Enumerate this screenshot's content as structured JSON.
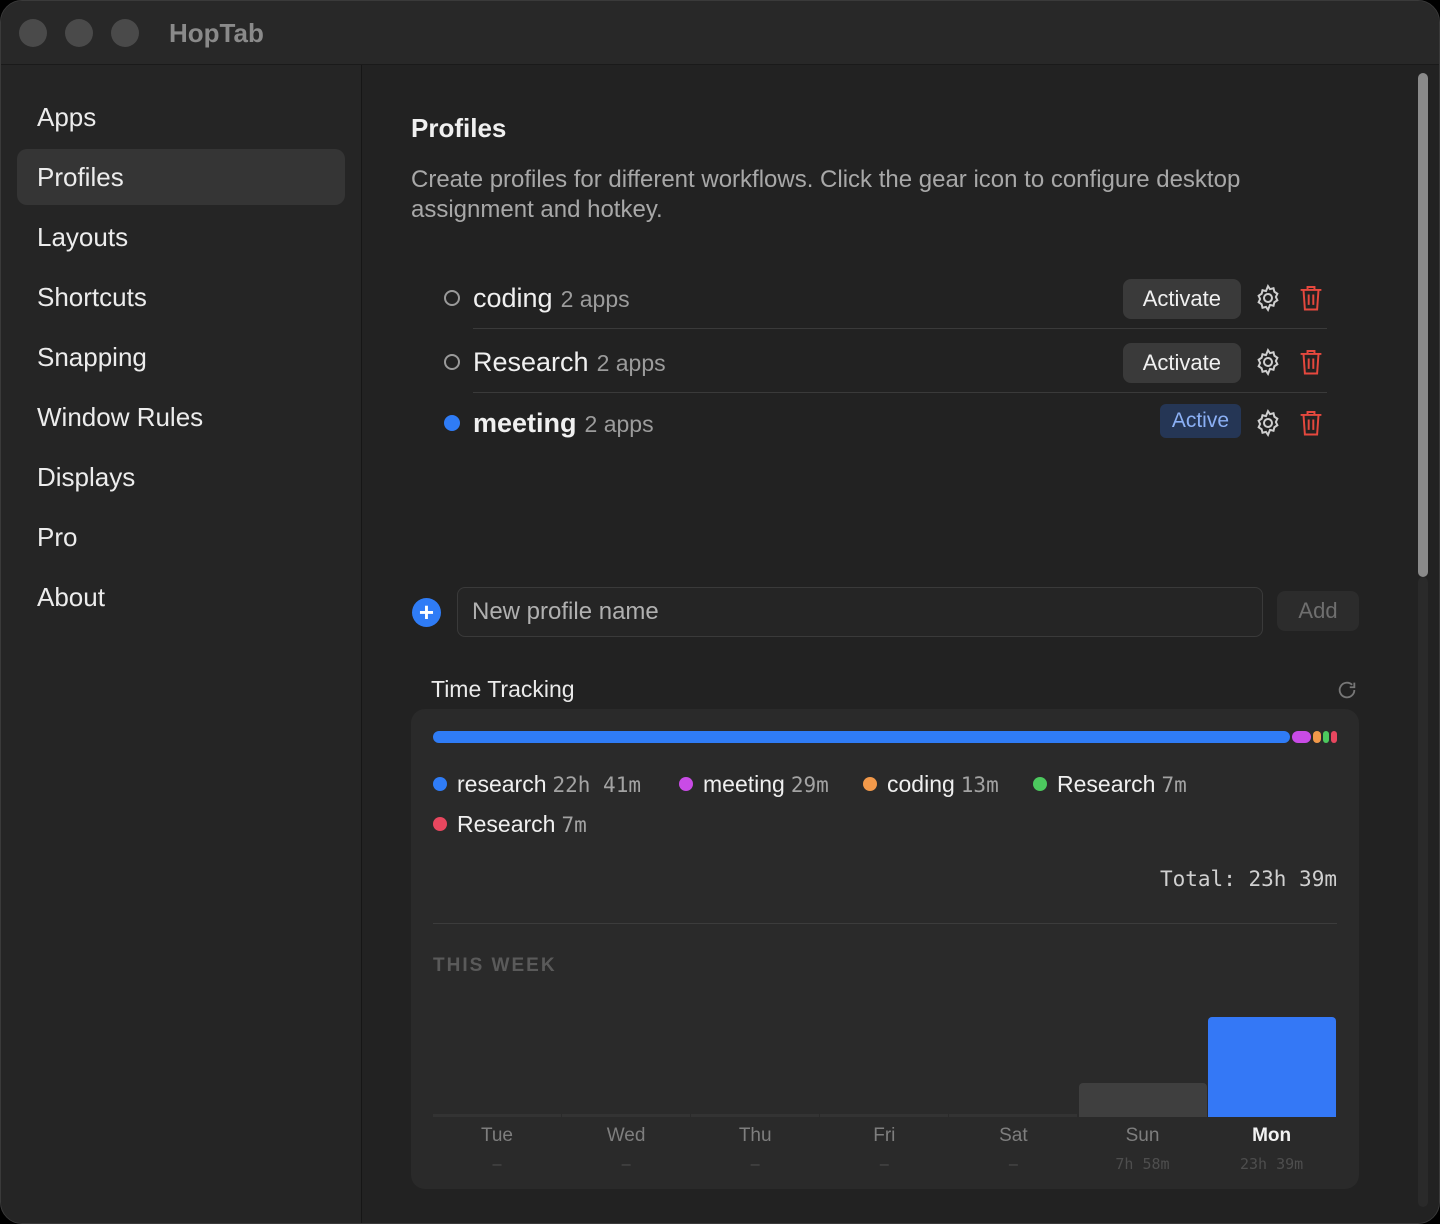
{
  "window": {
    "title": "HopTab"
  },
  "sidebar": {
    "items": [
      {
        "label": "Apps"
      },
      {
        "label": "Profiles",
        "selected": true
      },
      {
        "label": "Layouts"
      },
      {
        "label": "Shortcuts"
      },
      {
        "label": "Snapping"
      },
      {
        "label": "Window Rules"
      },
      {
        "label": "Displays"
      },
      {
        "label": "Pro"
      },
      {
        "label": "About"
      }
    ]
  },
  "main": {
    "title": "Profiles",
    "description": "Create profiles for different workflows. Click the gear icon to configure desktop assignment and hotkey.",
    "profiles": [
      {
        "name": "coding",
        "count": "2 apps",
        "action": "Activate",
        "active": false
      },
      {
        "name": "Research",
        "count": "2 apps",
        "action": "Activate",
        "active": false
      },
      {
        "name": "meeting",
        "count": "2 apps",
        "action": "Active",
        "active": true
      }
    ],
    "new_profile": {
      "placeholder": "New profile name",
      "add_label": "Add"
    }
  },
  "time_tracking": {
    "title": "Time Tracking",
    "distribution": [
      {
        "name": "research",
        "duration": "22h 41m",
        "color": "#2f7cf6",
        "minutes": 1361
      },
      {
        "name": "meeting",
        "duration": "29m",
        "color": "#c94be6",
        "minutes": 29
      },
      {
        "name": "coding",
        "duration": "13m",
        "color": "#f2994a",
        "minutes": 13
      },
      {
        "name": "Research",
        "duration": "7m",
        "color": "#4cc95e",
        "minutes": 7
      },
      {
        "name": "Research",
        "duration": "7m",
        "color": "#e8475f",
        "minutes": 7
      }
    ],
    "total": "Total: 23h 39m",
    "week_label": "THIS WEEK",
    "week": [
      {
        "day": "Tue",
        "value": "–",
        "hours": 0
      },
      {
        "day": "Wed",
        "value": "–",
        "hours": 0
      },
      {
        "day": "Thu",
        "value": "–",
        "hours": 0
      },
      {
        "day": "Fri",
        "value": "–",
        "hours": 0
      },
      {
        "day": "Sat",
        "value": "–",
        "hours": 0
      },
      {
        "day": "Sun",
        "value": "7h 58m",
        "hours": 7.97
      },
      {
        "day": "Mon",
        "value": "23h 39m",
        "hours": 23.65,
        "today": true
      }
    ],
    "colors": {
      "bar_today": "#3478f6",
      "bar_other": "#3f3f3f",
      "baseline": "#333333"
    }
  }
}
